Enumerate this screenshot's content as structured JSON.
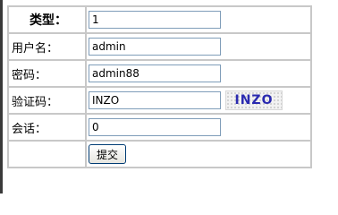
{
  "form": {
    "type_label": "类型：",
    "type_value": "1",
    "username_label": "用户名：",
    "username_value": "admin",
    "password_label": "密码：",
    "password_value": "admin88",
    "captcha_label": "验证码：",
    "captcha_value": "INZO",
    "captcha_image_text": "INZO",
    "session_label": "会话：",
    "session_value": "0",
    "submit_label": "提交"
  }
}
